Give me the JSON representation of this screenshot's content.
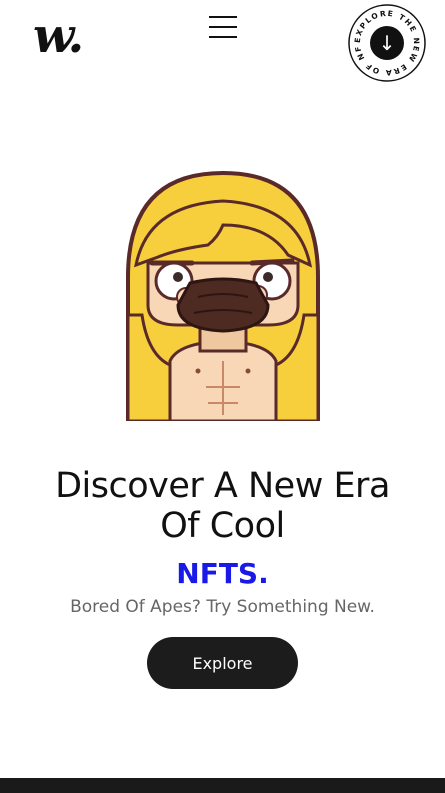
{
  "header": {
    "logo": "w.",
    "menu_icon": "hamburger-menu-icon",
    "badge": {
      "circular_text": "EXPLORE THE NEW ERA OF NFT.",
      "arrow": "↓"
    }
  },
  "hero": {
    "image": "nft-character-illustration",
    "title_line1": "Discover A New Era",
    "title_line2": "Of Cool",
    "highlight": "NFTS.",
    "subtitle": "Bored Of Apes? Try Something New.",
    "cta_label": "Explore"
  },
  "colors": {
    "accent": "#1a1ae8",
    "button": "#1c1c1c",
    "hair": "#f7cf3c",
    "skin": "#f7d7b6",
    "mask": "#4d2a22",
    "footer": "#1a1a1a"
  }
}
